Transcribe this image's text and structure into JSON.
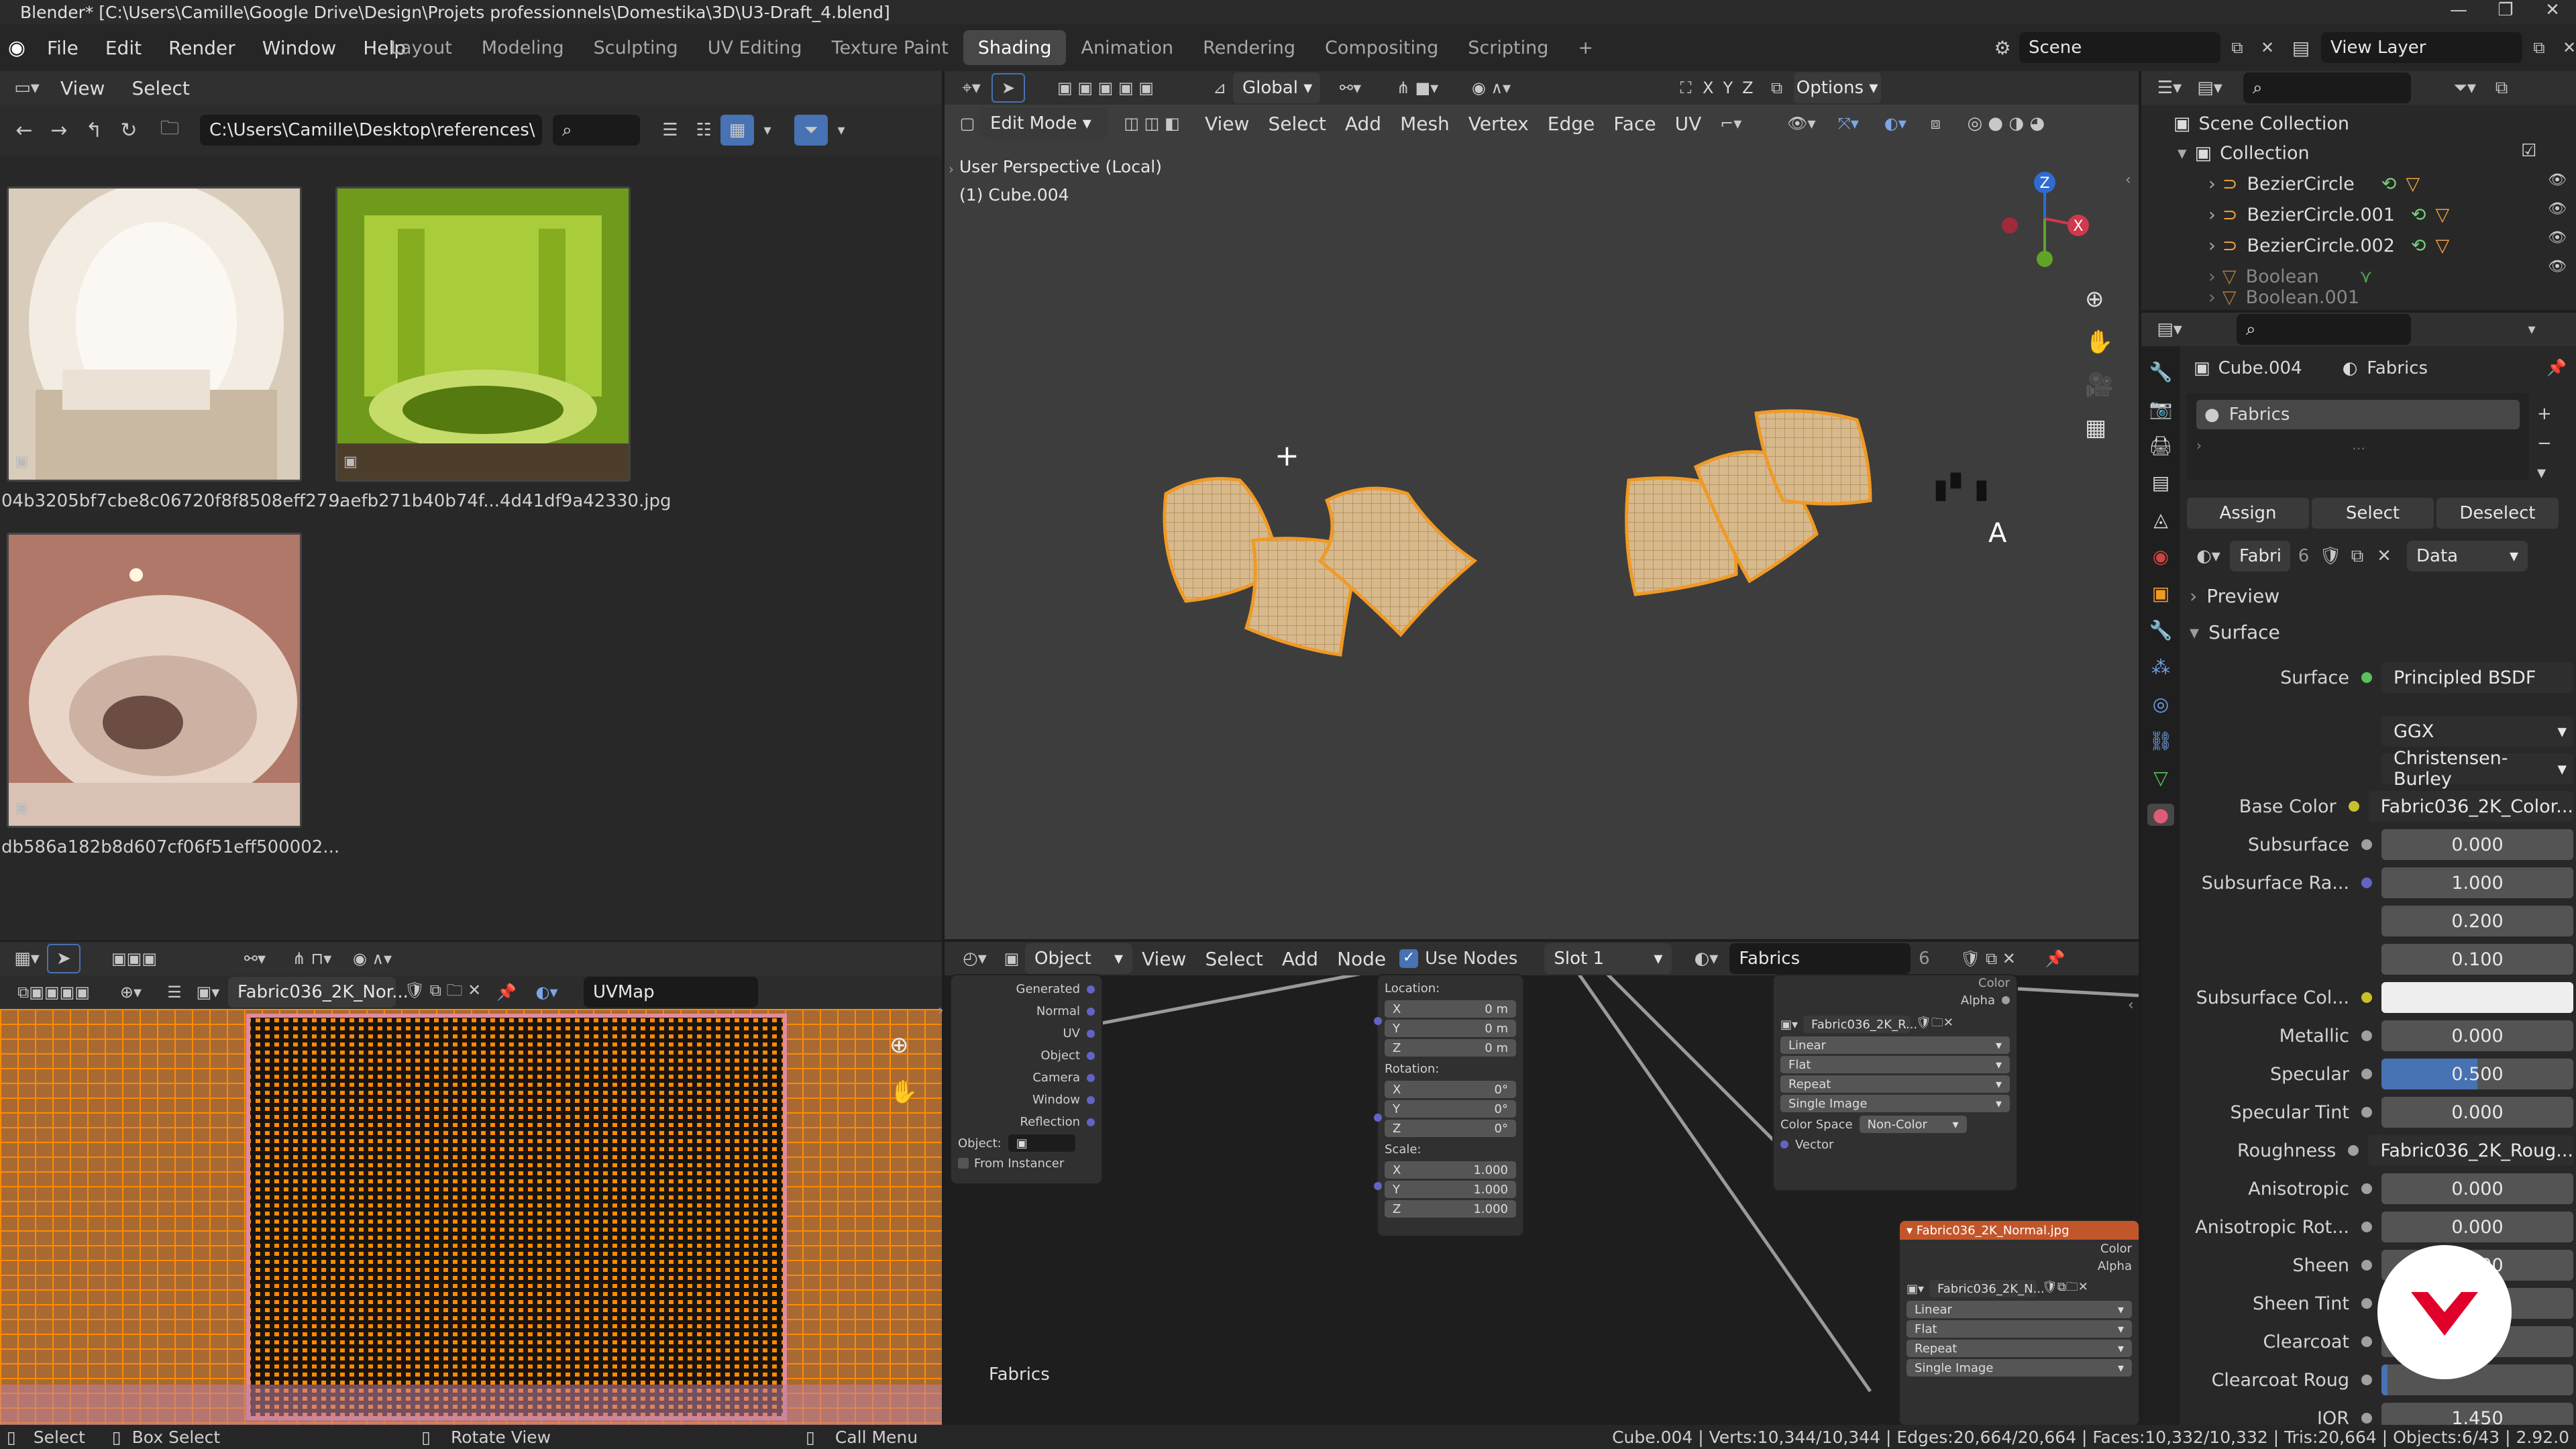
{
  "app": {
    "title": "Blender* [C:\\Users\\Camille\\Google Drive\\Design\\Projets professionnels\\Domestika\\3D\\U3-Draft_4.blend]",
    "menus": [
      "File",
      "Edit",
      "Render",
      "Window",
      "Help"
    ],
    "workspaces": [
      "Layout",
      "Modeling",
      "Sculpting",
      "UV Editing",
      "Texture Paint",
      "Shading",
      "Animation",
      "Rendering",
      "Compositing",
      "Scripting"
    ],
    "active_workspace": "Shading",
    "add_workspace": "+",
    "scene": "Scene",
    "view_layer": "View Layer"
  },
  "file_browser": {
    "menus": [
      "View",
      "Select"
    ],
    "path": "C:\\Users\\Camille\\Desktop\\references\\",
    "files": [
      {
        "name": "04b3205bf7cbe8c06720f8f8508eff27...",
        "colors": [
          "#e7ddd0",
          "#b9a995",
          "#f5efe6"
        ]
      },
      {
        "name": "9aefb271b40b74f...4d41df9a42330.jpg",
        "colors": [
          "#9cc12a",
          "#5f8a13",
          "#d0e07a"
        ]
      },
      {
        "name": "db586a182b8d607cf06f51eff500002...",
        "colors": [
          "#c99a8a",
          "#8a5a4e",
          "#e8cfc2"
        ]
      }
    ]
  },
  "viewport": {
    "mode": "Edit Mode",
    "orientation": "Global",
    "menus": [
      "View",
      "Select",
      "Add",
      "Mesh",
      "Vertex",
      "Edge",
      "Face",
      "UV"
    ],
    "options": "Options",
    "xyz": [
      "X",
      "Y",
      "Z"
    ],
    "overlay_title": "User Perspective (Local)",
    "overlay_object": "(1) Cube.004",
    "gizmo_x": "X",
    "gizmo_y": "Y",
    "gizmo_z": "Z",
    "marker_text": "A"
  },
  "uv_editor": {
    "image": "Fabric036_2K_Nor...",
    "uv_map": "UVMap"
  },
  "node_editor": {
    "type": "Object",
    "menus": [
      "View",
      "Select",
      "Add",
      "Node"
    ],
    "use_nodes": "Use Nodes",
    "slot": "Slot 1",
    "material": "Fabrics",
    "users": "6",
    "material_label": "Fabrics",
    "texcoord_outputs": [
      "Generated",
      "Normal",
      "UV",
      "Object",
      "Camera",
      "Window",
      "Reflection"
    ],
    "texcoord_object": "Object:",
    "from_instancer": "From Instancer",
    "mapping": {
      "location_label": "Location:",
      "rotation_label": "Rotation:",
      "scale_label": "Scale:",
      "location": [
        [
          "X",
          "0 m"
        ],
        [
          "Y",
          "0 m"
        ],
        [
          "Z",
          "0 m"
        ]
      ],
      "rotation": [
        [
          "X",
          "0°"
        ],
        [
          "Y",
          "0°"
        ],
        [
          "Z",
          "0°"
        ]
      ],
      "scale": [
        [
          "X",
          "1.000"
        ],
        [
          "Y",
          "1.000"
        ],
        [
          "Z",
          "1.000"
        ]
      ]
    },
    "tex1": {
      "outputs": [
        "Color",
        "Alpha"
      ],
      "image": "Fabric036_2K_R...",
      "interp": "Linear",
      "proj": "Flat",
      "ext": "Repeat",
      "source": "Single Image",
      "color_space_label": "Color Space",
      "color_space": "Non-Color",
      "vector": "Vector"
    },
    "tex2": {
      "title": "Fabric036_2K_Normal.jpg",
      "outputs": [
        "Color",
        "Alpha"
      ],
      "image": "Fabric036_2K_N...",
      "interp": "Linear",
      "proj": "Flat",
      "ext": "Repeat",
      "source": "Single Image"
    }
  },
  "outliner": {
    "root": "Scene Collection",
    "collection": "Collection",
    "items": [
      "BezierCircle",
      "BezierCircle.001",
      "BezierCircle.002",
      "Boolean",
      "Boolean.001"
    ]
  },
  "properties": {
    "object": "Cube.004",
    "material": "Fabrics",
    "slot_name": "Fabrics",
    "assign": "Assign",
    "select": "Select",
    "deselect": "Deselect",
    "mat_short": "Fabri",
    "mat_users": "6",
    "link": "Data",
    "preview": "Preview",
    "surface_section": "Surface",
    "surface_label": "Surface",
    "surface_shader": "Principled BSDF",
    "distribution": "GGX",
    "subsurface_method": "Christensen-Burley",
    "rows": [
      {
        "label": "Base Color",
        "value": "Fabric036_2K_Color...",
        "socket": "yellow",
        "kind": "link",
        "expand": true
      },
      {
        "label": "Subsurface",
        "value": "0.000",
        "socket": "gray",
        "kind": "num"
      },
      {
        "label": "Subsurface Ra...",
        "value": "1.000",
        "socket": "purple",
        "kind": "num"
      },
      {
        "label": "",
        "value": "0.200",
        "socket": "",
        "kind": "num"
      },
      {
        "label": "",
        "value": "0.100",
        "socket": "",
        "kind": "num"
      },
      {
        "label": "Subsurface Col...",
        "value": "",
        "socket": "yellow",
        "kind": "color"
      },
      {
        "label": "Metallic",
        "value": "0.000",
        "socket": "gray",
        "kind": "num"
      },
      {
        "label": "Specular",
        "value": "0.500",
        "socket": "gray",
        "kind": "slider",
        "fill": 0.5
      },
      {
        "label": "Specular Tint",
        "value": "0.000",
        "socket": "gray",
        "kind": "num"
      },
      {
        "label": "Roughness",
        "value": "Fabric036_2K_Roug...",
        "socket": "gray",
        "kind": "link",
        "expand": true
      },
      {
        "label": "Anisotropic",
        "value": "0.000",
        "socket": "gray",
        "kind": "num"
      },
      {
        "label": "Anisotropic Rot...",
        "value": "0.000",
        "socket": "gray",
        "kind": "num"
      },
      {
        "label": "Sheen",
        "value": "0.000",
        "socket": "gray",
        "kind": "num"
      },
      {
        "label": "Sheen Tint",
        "value": "",
        "socket": "gray",
        "kind": "slider",
        "fill": 0.5
      },
      {
        "label": "Clearcoat",
        "value": "",
        "socket": "gray",
        "kind": "num"
      },
      {
        "label": "Clearcoat Roug",
        "value": "",
        "socket": "gray",
        "kind": "slider",
        "fill": 0.03
      },
      {
        "label": "IOR",
        "value": "1.450",
        "socket": "gray",
        "kind": "num"
      }
    ]
  },
  "status": {
    "select": "Select",
    "box_select": "Box Select",
    "rotate": "Rotate View",
    "call_menu": "Call Menu",
    "stats": "Cube.004 | Verts:10,344/10,344 | Edges:20,664/20,664 | Faces:10,332/10,332 | Tris:20,664 | Objects:6/43 | 2.92.0"
  },
  "colors": {
    "accent": "#4772b3",
    "selection": "#ff8a00",
    "window_bg": "#3d3d3d",
    "header_bg": "#303030"
  }
}
